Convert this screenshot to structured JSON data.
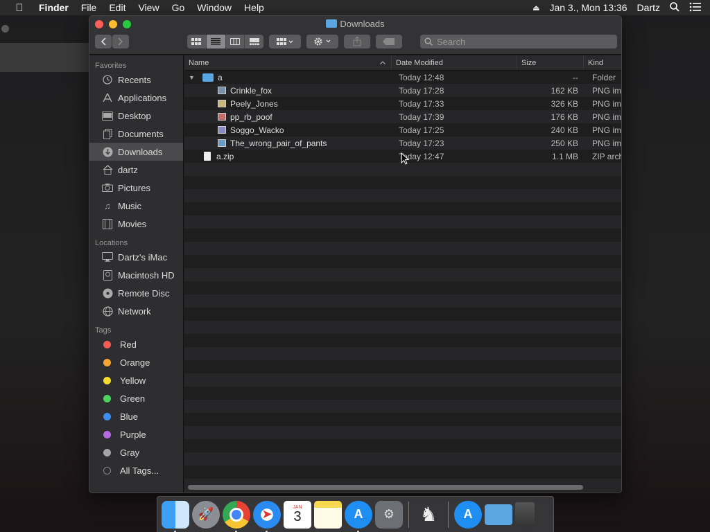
{
  "menubar": {
    "apple": "",
    "app": "Finder",
    "items": [
      "File",
      "Edit",
      "View",
      "Go",
      "Window",
      "Help"
    ],
    "datetime": "Jan 3., Mon 13:36",
    "user": "Dartz"
  },
  "window": {
    "title": "Downloads",
    "search_placeholder": "Search"
  },
  "sidebar": {
    "favorites_title": "Favorites",
    "favorites": [
      {
        "label": "Recents",
        "icon": "clock-icon"
      },
      {
        "label": "Applications",
        "icon": "applications-icon"
      },
      {
        "label": "Desktop",
        "icon": "desktop-icon"
      },
      {
        "label": "Documents",
        "icon": "documents-icon"
      },
      {
        "label": "Downloads",
        "icon": "downloads-icon"
      },
      {
        "label": "dartz",
        "icon": "home-icon"
      },
      {
        "label": "Pictures",
        "icon": "camera-icon"
      },
      {
        "label": "Music",
        "icon": "music-icon"
      },
      {
        "label": "Movies",
        "icon": "film-icon"
      }
    ],
    "locations_title": "Locations",
    "locations": [
      {
        "label": "Dartz's iMac",
        "icon": "imac-icon"
      },
      {
        "label": "Macintosh HD",
        "icon": "disk-icon"
      },
      {
        "label": "Remote Disc",
        "icon": "disc-icon"
      },
      {
        "label": "Network",
        "icon": "globe-icon"
      }
    ],
    "tags_title": "Tags",
    "tags": [
      {
        "label": "Red",
        "color": "#f25c54"
      },
      {
        "label": "Orange",
        "color": "#f7a534"
      },
      {
        "label": "Yellow",
        "color": "#f5dc2e"
      },
      {
        "label": "Green",
        "color": "#4cd35f"
      },
      {
        "label": "Blue",
        "color": "#3c8ef0"
      },
      {
        "label": "Purple",
        "color": "#b46be0"
      },
      {
        "label": "Gray",
        "color": "#a5a5a8"
      },
      {
        "label": "All Tags...",
        "color": ""
      }
    ]
  },
  "columns": {
    "name": "Name",
    "date": "Date Modified",
    "size": "Size",
    "kind": "Kind"
  },
  "files": [
    {
      "name": "a",
      "date": "Today 12:48",
      "size": "--",
      "kind": "Folder"
    },
    {
      "name": "Crinkle_fox",
      "date": "Today 17:28",
      "size": "162 KB",
      "kind": "PNG ima"
    },
    {
      "name": "Peely_Jones",
      "date": "Today 17:33",
      "size": "326 KB",
      "kind": "PNG ima"
    },
    {
      "name": "pp_rb_poof",
      "date": "Today 17:39",
      "size": "176 KB",
      "kind": "PNG ima"
    },
    {
      "name": "Soggo_Wacko",
      "date": "Today 17:25",
      "size": "240 KB",
      "kind": "PNG ima"
    },
    {
      "name": "The_wrong_pair_of_pants",
      "date": "Today 17:23",
      "size": "250 KB",
      "kind": "PNG ima"
    },
    {
      "name": "a.zip",
      "date": "Today 12:47",
      "size": "1.1 MB",
      "kind": "ZIP arch"
    }
  ],
  "dock": {
    "calendar_month": "JAN",
    "calendar_day": "3"
  }
}
